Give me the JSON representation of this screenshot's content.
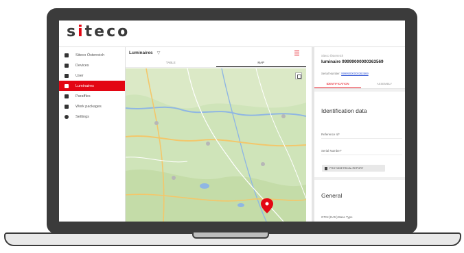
{
  "app": {
    "logo_text": "siteco",
    "accent_color": "#e30613"
  },
  "sidebar": {
    "items": [
      {
        "label": "Siteco Österreich",
        "icon": "building-icon",
        "active": false
      },
      {
        "label": "Devices",
        "icon": "device-tree-icon",
        "active": false
      },
      {
        "label": "User",
        "icon": "users-icon",
        "active": false
      },
      {
        "label": "Luminaires",
        "icon": "bulb-icon",
        "active": true
      },
      {
        "label": "Paraffles",
        "icon": "grid-icon",
        "active": false
      },
      {
        "label": "Work packages",
        "icon": "briefcase-icon",
        "active": false
      },
      {
        "label": "Settings",
        "icon": "gear-icon",
        "active": false
      }
    ]
  },
  "list": {
    "title": "Luminaires",
    "tabs": [
      "TABLE",
      "MAP"
    ],
    "active_tab": "MAP"
  },
  "detail": {
    "breadcrumb": "Siteco Österreich",
    "title": "luminaire 99999000000363569",
    "serial_label": "Serial Number:",
    "serial_value": "99999000000363569",
    "tabs": [
      "IDENTIFICATION",
      "ASSEMBLY"
    ],
    "active_tab": "IDENTIFICATION",
    "section1_title": "Identification data",
    "reference_label": "Reference Id*",
    "serial_field_label": "Serial Number*",
    "report_button": "PHOTOMETRICAL REPORT",
    "section2_title": "General",
    "gtin_label": "GTIN (EAN) Base Type"
  }
}
